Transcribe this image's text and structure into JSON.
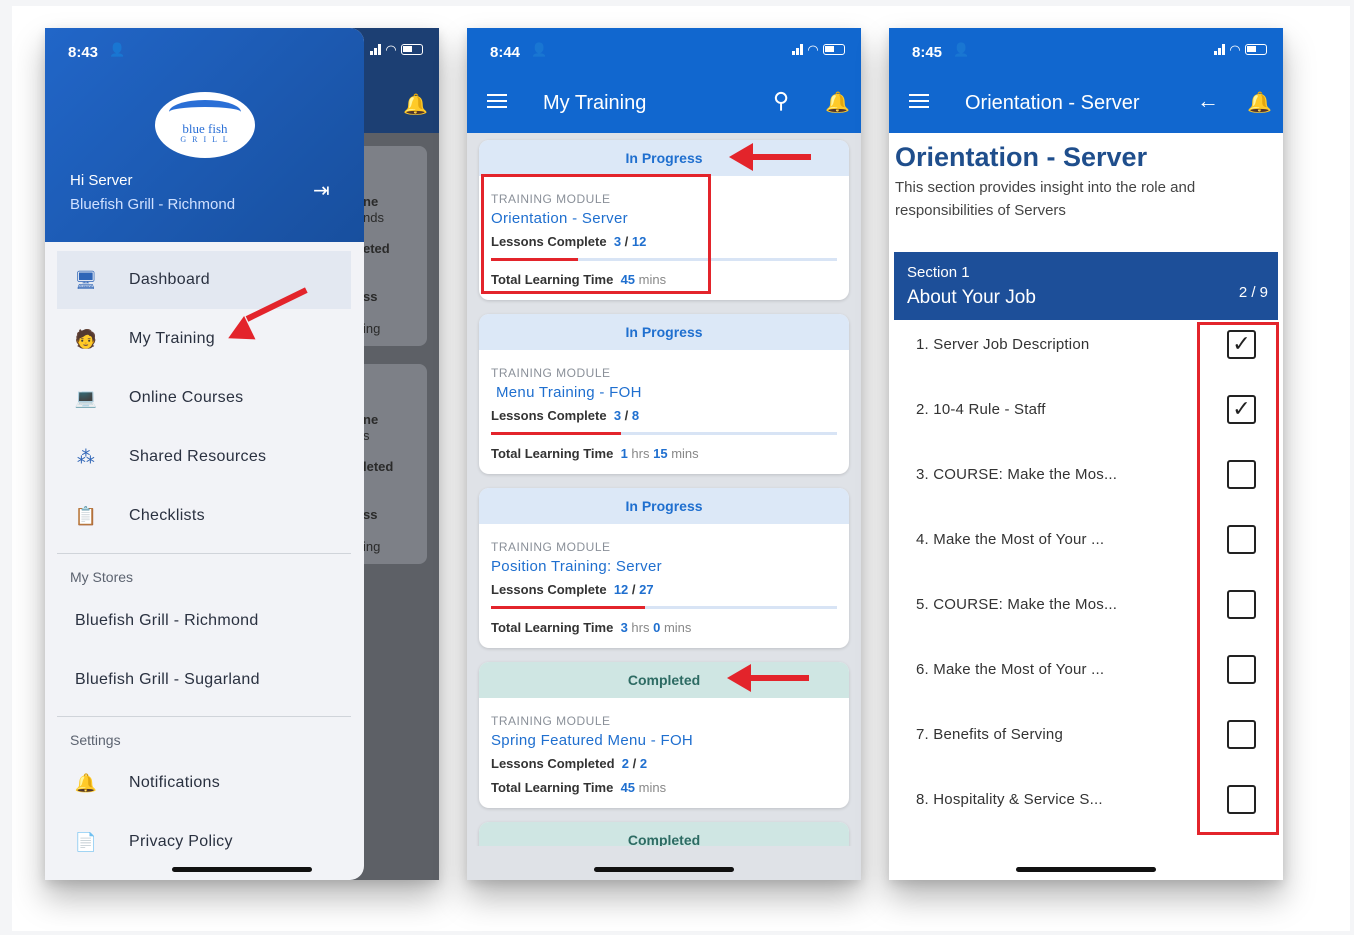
{
  "phone1": {
    "time": "8:43",
    "logo": {
      "line1": "blue fish",
      "line2": "G R I L L"
    },
    "greeting": "Hi Server",
    "store": "Bluefish Grill - Richmond",
    "menu": [
      {
        "label": "Dashboard",
        "icon": "monitor-icon"
      },
      {
        "label": "My Training",
        "icon": "trainee-icon"
      },
      {
        "label": "Online Courses",
        "icon": "laptop-icon"
      },
      {
        "label": "Shared Resources",
        "icon": "share-nodes-icon"
      },
      {
        "label": "Checklists",
        "icon": "clipboard-icon"
      }
    ],
    "stores_heading": "My Stores",
    "stores": [
      "Bluefish Grill - Richmond",
      "Bluefish Grill - Sugarland"
    ],
    "settings_heading": "Settings",
    "settings": [
      {
        "label": "Notifications",
        "icon": "bell-icon"
      },
      {
        "label": "Privacy Policy",
        "icon": "privacy-icon"
      }
    ],
    "peek": [
      "ne",
      "nds",
      "eted",
      "ss",
      "ing",
      "ne",
      "s",
      "leted",
      "ss",
      "ing"
    ]
  },
  "phone2": {
    "time": "8:44",
    "title": "My Training",
    "cards": [
      {
        "status": "In Progress",
        "type": "TRAINING MODULE",
        "name": "Orientation - Server",
        "lessons_label": "Lessons Complete",
        "done": "3",
        "total": "12",
        "progress": 0.25,
        "time_label": "Total Learning Time",
        "hrs": "",
        "mins": "45",
        "hrs_unit": "",
        "mins_unit": "mins"
      },
      {
        "status": "In Progress",
        "type": "TRAINING MODULE",
        "name": "Menu Training - FOH",
        "lessons_label": "Lessons Complete",
        "done": "3",
        "total": "8",
        "progress": 0.375,
        "time_label": "Total Learning Time",
        "hrs": "1",
        "mins": "15",
        "hrs_unit": "hrs",
        "mins_unit": "mins"
      },
      {
        "status": "In Progress",
        "type": "TRAINING MODULE",
        "name": "Position Training: Server",
        "lessons_label": "Lessons Complete",
        "done": "12",
        "total": "27",
        "progress": 0.444,
        "time_label": "Total Learning Time",
        "hrs": "3",
        "mins": "0",
        "hrs_unit": "hrs",
        "mins_unit": "mins"
      },
      {
        "status": "Completed",
        "type": "TRAINING MODULE",
        "name": "Spring Featured Menu - FOH",
        "lessons_label": "Lessons Completed",
        "done": "2",
        "total": "2",
        "progress": 1,
        "time_label": "Total Learning Time",
        "hrs": "",
        "mins": "45",
        "hrs_unit": "",
        "mins_unit": "mins"
      }
    ],
    "last_status": "Completed"
  },
  "phone3": {
    "time": "8:45",
    "title": "Orientation - Server",
    "heading": "Orientation - Server",
    "description": "This section provides insight into the role and responsibilities of Servers",
    "section_label": "Section 1",
    "section_title": "About Your Job",
    "section_count": "2 / 9",
    "lessons": [
      {
        "label": "1.  Server Job Description",
        "checked": true
      },
      {
        "label": "2.  10-4 Rule - Staff",
        "checked": true
      },
      {
        "label": "3.  COURSE: Make the Mos...",
        "checked": false
      },
      {
        "label": "4.  Make the Most of Your ...",
        "checked": false
      },
      {
        "label": "5.  COURSE: Make the Mos...",
        "checked": false
      },
      {
        "label": "6.  Make the Most of Your ...",
        "checked": false
      },
      {
        "label": "7.  Benefits of Serving",
        "checked": false
      },
      {
        "label": "8.  Hospitality & Service S...",
        "checked": false
      }
    ],
    "check_glyph": "✓"
  },
  "colors": {
    "brand": "#1167cf",
    "annotation": "#e3242b",
    "section": "#1d4f99"
  }
}
